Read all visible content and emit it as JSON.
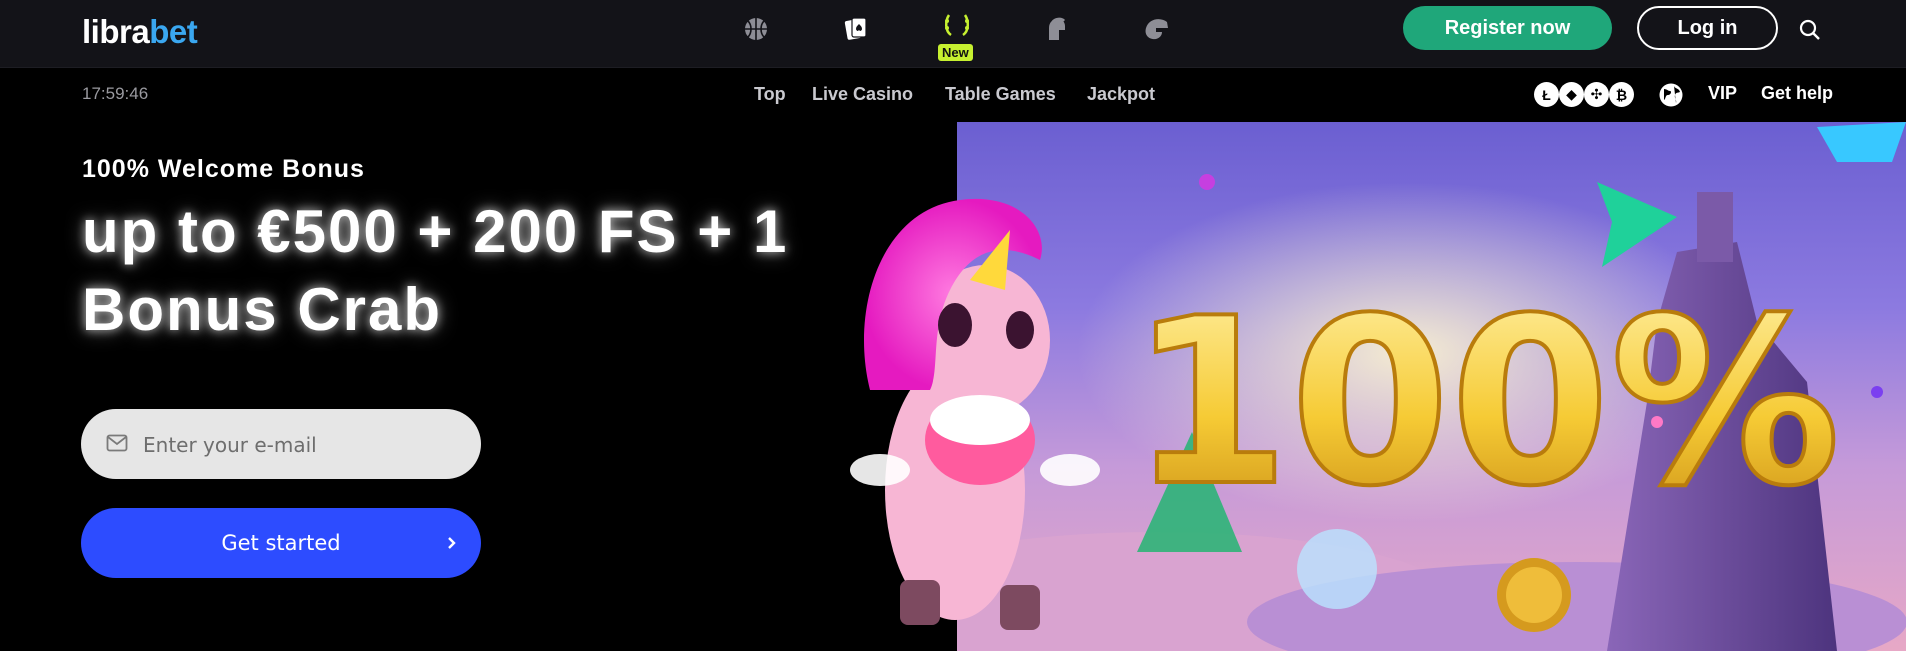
{
  "header": {
    "logo_left": "libra",
    "logo_right": "bet",
    "categories": [
      {
        "icon": "basketball-icon"
      },
      {
        "icon": "cards-icon"
      },
      {
        "icon": "laurel-icon",
        "badge": "New"
      },
      {
        "icon": "spartan-helmet-icon"
      },
      {
        "icon": "racing-icon"
      }
    ],
    "register_label": "Register now",
    "login_label": "Log in",
    "search_icon": "search-icon"
  },
  "subnav": {
    "clock": "17:59:46",
    "links": [
      "Top",
      "Live Casino",
      "Table Games",
      "Jackpot"
    ],
    "crypto_icons": [
      "litecoin-icon",
      "ethereum-icon",
      "ripple-icon",
      "bitcoin-icon"
    ],
    "globe_icon": "globe-icon",
    "vip_label": "VIP",
    "help_label": "Get help"
  },
  "hero": {
    "subtitle": "100% Welcome Bonus",
    "headline": "up to €500 + 200 FS + 1 Bonus Crab",
    "email_placeholder": "Enter your e-mail",
    "cta_label": "Get started"
  },
  "banner": {
    "text": "100%"
  },
  "colors": {
    "register": "#1fa77a",
    "cta": "#2d4cff",
    "logo_accent": "#3aa7f0",
    "new_badge": "#c6f030"
  }
}
